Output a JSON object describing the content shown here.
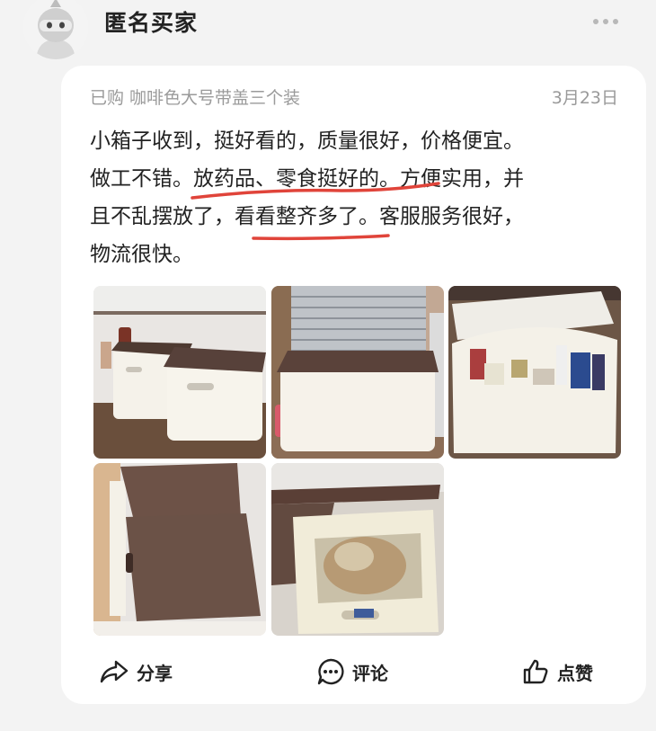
{
  "user": {
    "name": "匿名买家",
    "avatar_icon": "ninja-avatar-icon",
    "more_icon": "more-dots-icon"
  },
  "review": {
    "purchase_info": "已购 咖啡色大号带盖三个装",
    "date": "3月23日",
    "lines": [
      "小箱子收到，挺好看的，质量很好，价格便宜。",
      "做工不错。放药品、零食挺好的。方便实用，并",
      "且不乱摆放了，看看整齐多了。客服服务很好，",
      "物流很快。"
    ],
    "highlight_color": "#e0443a",
    "photos": [
      {
        "description_icon": "two-storage-boxes-photo"
      },
      {
        "description_icon": "closed-storage-box-photo"
      },
      {
        "description_icon": "open-box-with-medicine-photo"
      },
      {
        "description_icon": "box-lid-closeup-photo"
      },
      {
        "description_icon": "open-box-with-snacks-photo"
      }
    ]
  },
  "actions": {
    "share": {
      "label": "分享",
      "icon": "share-arrow-icon"
    },
    "comment": {
      "label": "评论",
      "icon": "comment-bubble-icon"
    },
    "like": {
      "label": "点赞",
      "icon": "thumbs-up-icon"
    }
  }
}
